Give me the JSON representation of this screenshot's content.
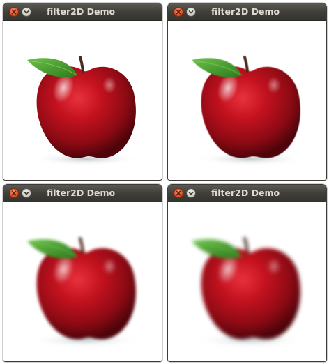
{
  "windows": [
    {
      "title": "filter2D Demo"
    },
    {
      "title": "filter2D Demo"
    },
    {
      "title": "filter2D Demo"
    },
    {
      "title": "filter2D Demo"
    }
  ],
  "icons": {
    "close": "close-icon",
    "minimize": "minimize-icon"
  },
  "colors": {
    "titlebar": "#3e3d39",
    "title_text": "#dfdbd2",
    "close_button": "#e0552b",
    "apple_red": "#b01020",
    "leaf_green": "#3f9a2a"
  }
}
